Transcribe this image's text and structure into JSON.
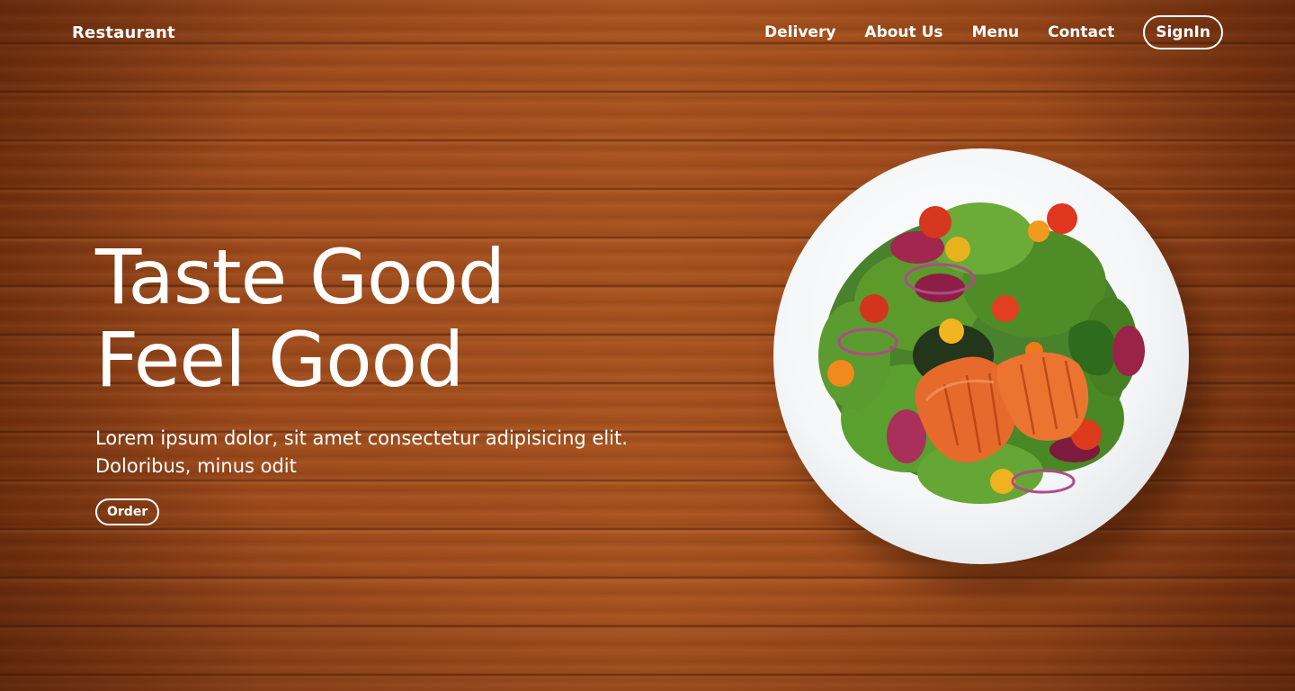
{
  "header": {
    "brand": "Restaurant",
    "nav": [
      "Delivery",
      "About Us",
      "Menu",
      "Contact"
    ],
    "signin_label": "SignIn"
  },
  "hero": {
    "title_line1": "Taste Good",
    "title_line2": "Feel Good",
    "description_line1": "Lorem ipsum dolor, sit amet consectetur adipisicing elit.",
    "description_line2": "Doloribus, minus odit",
    "order_label": "Order"
  },
  "colors": {
    "wood": "#9c4a1c",
    "text": "#ffffff",
    "plate": "#f4f6f7",
    "salmon": "#e8632a"
  },
  "images": {
    "hero_dish": "salmon-salad-plate"
  }
}
